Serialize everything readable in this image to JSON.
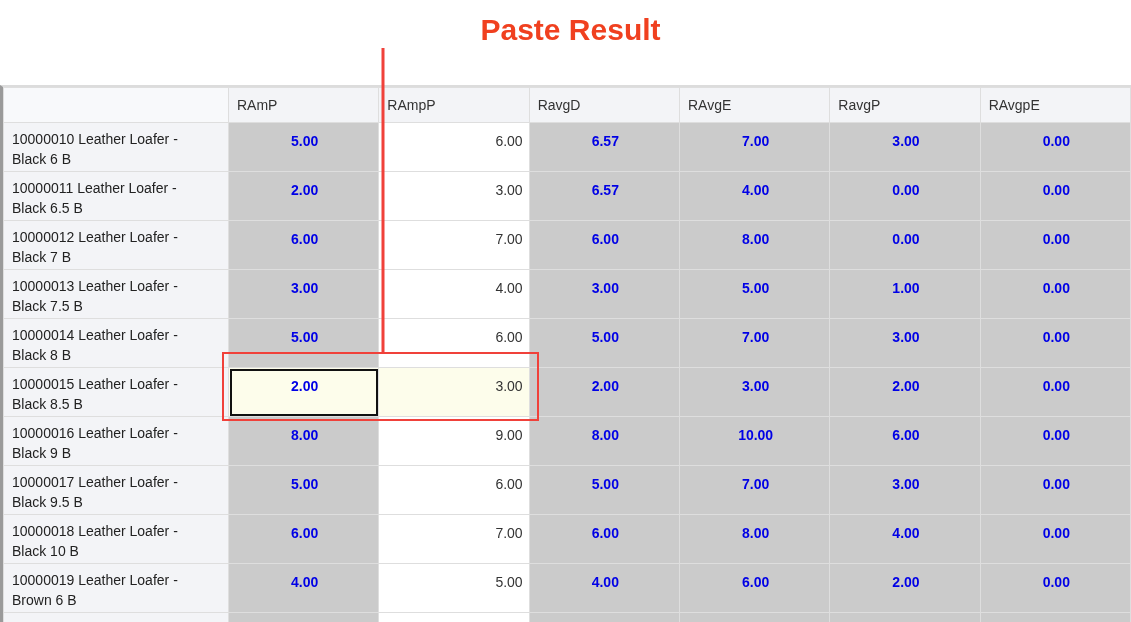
{
  "callout": {
    "title": "Paste Result"
  },
  "table": {
    "columns": [
      {
        "label": "RAmP",
        "kind": "calculated"
      },
      {
        "label": "RAmpP",
        "kind": "input"
      },
      {
        "label": "RavgD",
        "kind": "calculated"
      },
      {
        "label": "RAvgE",
        "kind": "calculated"
      },
      {
        "label": "RavgP",
        "kind": "calculated"
      },
      {
        "label": "RAvgpE",
        "kind": "calculated"
      }
    ],
    "rows": [
      {
        "name": "10000010 Leather Loafer - Black 6 B",
        "cells": [
          {
            "v": "5.00",
            "selected": false
          },
          {
            "v": "6.00",
            "selected": false
          },
          {
            "v": "6.57",
            "selected": false
          },
          {
            "v": "7.00",
            "selected": false
          },
          {
            "v": "3.00",
            "selected": false
          },
          {
            "v": "0.00",
            "selected": false
          }
        ]
      },
      {
        "name": "10000011 Leather Loafer - Black 6.5 B",
        "cells": [
          {
            "v": "2.00",
            "selected": false
          },
          {
            "v": "3.00",
            "selected": false
          },
          {
            "v": "6.57",
            "selected": false
          },
          {
            "v": "4.00",
            "selected": false
          },
          {
            "v": "0.00",
            "selected": false
          },
          {
            "v": "0.00",
            "selected": false
          }
        ]
      },
      {
        "name": "10000012 Leather Loafer - Black 7 B",
        "cells": [
          {
            "v": "6.00",
            "selected": false
          },
          {
            "v": "7.00",
            "selected": false
          },
          {
            "v": "6.00",
            "selected": false
          },
          {
            "v": "8.00",
            "selected": false
          },
          {
            "v": "0.00",
            "selected": false
          },
          {
            "v": "0.00",
            "selected": false
          }
        ]
      },
      {
        "name": "10000013 Leather Loafer - Black 7.5 B",
        "cells": [
          {
            "v": "3.00",
            "selected": false
          },
          {
            "v": "4.00",
            "selected": false
          },
          {
            "v": "3.00",
            "selected": false
          },
          {
            "v": "5.00",
            "selected": false
          },
          {
            "v": "1.00",
            "selected": false
          },
          {
            "v": "0.00",
            "selected": false
          }
        ]
      },
      {
        "name": "10000014 Leather Loafer - Black 8 B",
        "cells": [
          {
            "v": "5.00",
            "selected": false
          },
          {
            "v": "6.00",
            "selected": false
          },
          {
            "v": "5.00",
            "selected": false
          },
          {
            "v": "7.00",
            "selected": false
          },
          {
            "v": "3.00",
            "selected": false
          },
          {
            "v": "0.00",
            "selected": false
          }
        ]
      },
      {
        "name": "10000015 Leather Loafer - Black 8.5 B",
        "cells": [
          {
            "v": "2.00",
            "selected": true
          },
          {
            "v": "3.00",
            "selected": true
          },
          {
            "v": "2.00",
            "selected": false
          },
          {
            "v": "3.00",
            "selected": false
          },
          {
            "v": "2.00",
            "selected": false
          },
          {
            "v": "0.00",
            "selected": false
          }
        ]
      },
      {
        "name": "10000016 Leather Loafer - Black 9 B",
        "cells": [
          {
            "v": "8.00",
            "selected": false
          },
          {
            "v": "9.00",
            "selected": false
          },
          {
            "v": "8.00",
            "selected": false
          },
          {
            "v": "10.00",
            "selected": false
          },
          {
            "v": "6.00",
            "selected": false
          },
          {
            "v": "0.00",
            "selected": false
          }
        ]
      },
      {
        "name": "10000017 Leather Loafer - Black 9.5 B",
        "cells": [
          {
            "v": "5.00",
            "selected": false
          },
          {
            "v": "6.00",
            "selected": false
          },
          {
            "v": "5.00",
            "selected": false
          },
          {
            "v": "7.00",
            "selected": false
          },
          {
            "v": "3.00",
            "selected": false
          },
          {
            "v": "0.00",
            "selected": false
          }
        ]
      },
      {
        "name": "10000018 Leather Loafer - Black 10 B",
        "cells": [
          {
            "v": "6.00",
            "selected": false
          },
          {
            "v": "7.00",
            "selected": false
          },
          {
            "v": "6.00",
            "selected": false
          },
          {
            "v": "8.00",
            "selected": false
          },
          {
            "v": "4.00",
            "selected": false
          },
          {
            "v": "0.00",
            "selected": false
          }
        ]
      },
      {
        "name": "10000019 Leather Loafer - Brown 6 B",
        "cells": [
          {
            "v": "4.00",
            "selected": false
          },
          {
            "v": "5.00",
            "selected": false
          },
          {
            "v": "4.00",
            "selected": false
          },
          {
            "v": "6.00",
            "selected": false
          },
          {
            "v": "2.00",
            "selected": false
          },
          {
            "v": "0.00",
            "selected": false
          }
        ]
      }
    ]
  }
}
